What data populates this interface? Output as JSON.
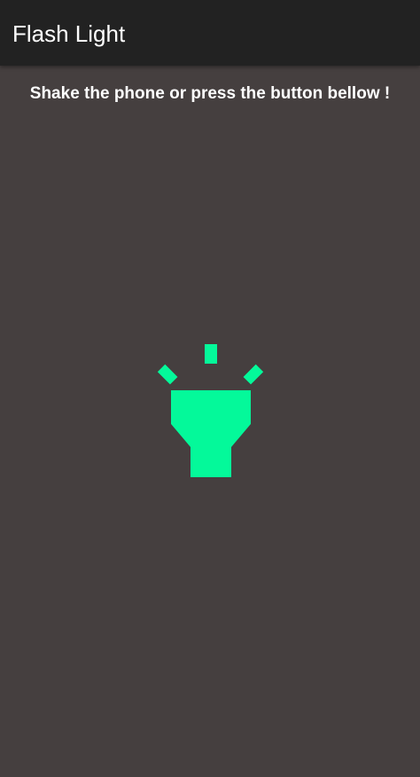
{
  "app_bar": {
    "title": "Flash Light"
  },
  "main": {
    "instructions": "Shake the phone or press the button bellow !",
    "flashlight_button": {
      "icon": "flashlight-icon",
      "state": "on"
    }
  },
  "colors": {
    "app_bar_background": "#222222",
    "page_background": "#453f3f",
    "accent": "#04f99a",
    "text": "#ffffff"
  }
}
